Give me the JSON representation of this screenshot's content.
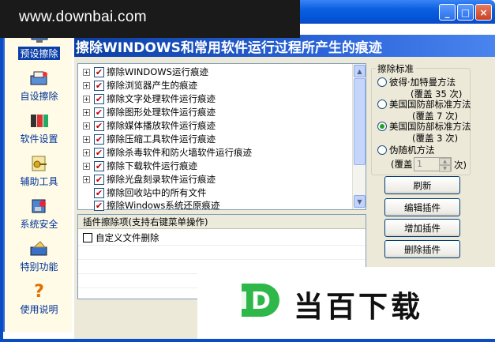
{
  "watermark": {
    "text": "www.downbai.com"
  },
  "window": {
    "min": "_",
    "max": "□",
    "close": "×"
  },
  "banner": {
    "title": "擦除WINDOWS和常用软件运行过程所产生的痕迹"
  },
  "sidebar": {
    "items": [
      {
        "label": "预设擦除",
        "icon": "preset-erase-icon",
        "active": true
      },
      {
        "label": "自设擦除",
        "icon": "custom-erase-icon",
        "active": false
      },
      {
        "label": "软件设置",
        "icon": "settings-icon",
        "active": false
      },
      {
        "label": "辅助工具",
        "icon": "tools-icon",
        "active": false
      },
      {
        "label": "系统安全",
        "icon": "security-icon",
        "active": false
      },
      {
        "label": "特别功能",
        "icon": "special-icon",
        "active": false
      },
      {
        "label": "使用说明",
        "icon": "help-icon",
        "active": false
      }
    ]
  },
  "tree": {
    "items": [
      {
        "label": "擦除WINDOWS运行痕迹",
        "expandable": true
      },
      {
        "label": "擦除浏览器产生的痕迹",
        "expandable": true
      },
      {
        "label": "擦除文字处理软件运行痕迹",
        "expandable": true
      },
      {
        "label": "擦除图形处理软件运行痕迹",
        "expandable": true
      },
      {
        "label": "擦除媒体播放软件运行痕迹",
        "expandable": true
      },
      {
        "label": "擦除压缩工具软件运行痕迹",
        "expandable": true
      },
      {
        "label": "擦除杀毒软件和防火墙软件运行痕迹",
        "expandable": true
      },
      {
        "label": "擦除下载软件运行痕迹",
        "expandable": true
      },
      {
        "label": "擦除光盘刻录软件运行痕迹",
        "expandable": true
      },
      {
        "label": "擦除回收站中的所有文件",
        "expandable": false
      },
      {
        "label": "擦除Windows系统还原痕迹",
        "expandable": false
      }
    ]
  },
  "plugins": {
    "header": "插件擦除项(支持右键菜单操作)",
    "items": [
      {
        "label": "自定义文件删除"
      }
    ]
  },
  "standard": {
    "title": "擦除标准",
    "options": [
      {
        "label": "彼得·加特曼方法",
        "sub": "(覆盖 35 次)",
        "selected": false
      },
      {
        "label": "美国国防部标准方法",
        "sub": "(覆盖 7 次)",
        "selected": false
      },
      {
        "label": "美国国防部标准方法",
        "sub": "(覆盖 3 次)",
        "selected": true
      },
      {
        "label": "伪随机方法",
        "sub": "",
        "selected": false
      }
    ],
    "spin_prefix": "(覆盖",
    "spin_value": "1",
    "spin_suffix": "次)"
  },
  "buttons": {
    "refresh": "刷新",
    "edit_plugin": "编辑插件",
    "add_plugin": "增加插件",
    "delete_plugin": "删除插件"
  },
  "ad": {
    "logo_letter": "D",
    "text": "当百下载"
  }
}
